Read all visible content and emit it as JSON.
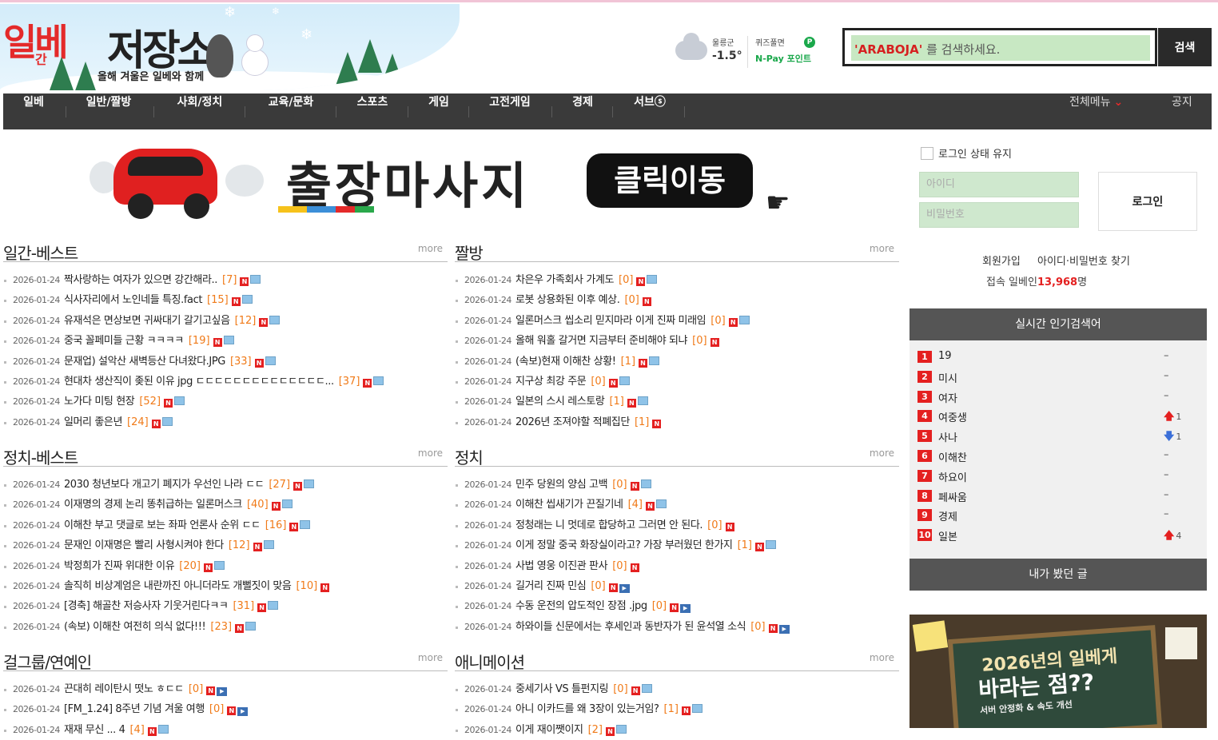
{
  "logo": {
    "t1": "일베",
    "t2": "간",
    "t3": "저장소",
    "subtitle": "올해 겨울은 일베와 함께"
  },
  "weather": {
    "location": "울릉군",
    "temp": "-1.5°"
  },
  "quiz": {
    "line1": "퀴즈풀면",
    "line2": "N-Pay 포인트",
    "badge": "P"
  },
  "search": {
    "placeholder_highlight": "'ARABOJA'",
    "placeholder_rest": " 를 검색하세요.",
    "button": "검색"
  },
  "nav": {
    "items": [
      "일베",
      "일반/짤방",
      "사회/정치",
      "교육/문화",
      "스포츠",
      "게임",
      "고전게임",
      "경제",
      "서브ⓢ"
    ],
    "all_menu": "전체메뉴",
    "notice": "공지"
  },
  "banner": {
    "text": "출장마사지",
    "button": "클릭이동"
  },
  "sections": [
    {
      "title": "일간-베스트",
      "more": "more",
      "rows": [
        {
          "date": "2026-01-24",
          "title": "짝사랑하는 여자가 있으면 강간해라..",
          "count": "[7]",
          "icons": [
            "n",
            "p"
          ]
        },
        {
          "date": "2026-01-24",
          "title": "식사자리에서 노인네들 특징.fact",
          "count": "[15]",
          "icons": [
            "n",
            "p"
          ]
        },
        {
          "date": "2026-01-24",
          "title": "유재석은 면상보면 귀싸대기 갈기고싶음",
          "count": "[12]",
          "icons": [
            "n",
            "p"
          ]
        },
        {
          "date": "2026-01-24",
          "title": "중국 꼴페미들 근황 ㅋㅋㅋㅋ",
          "count": "[19]",
          "icons": [
            "n",
            "p"
          ]
        },
        {
          "date": "2026-01-24",
          "title": "문재업) 설악산 새벽등산 다녀왔다.JPG",
          "count": "[33]",
          "icons": [
            "n",
            "p"
          ]
        },
        {
          "date": "2026-01-24",
          "title": "현대차 생산직이 좆된 이유 jpg ㄷㄷㄷㄷㄷㄷㄷㄷㄷㄷㄷㄷㄷㄷ...",
          "count": "[37]",
          "icons": [
            "n",
            "p"
          ]
        },
        {
          "date": "2026-01-24",
          "title": "노가다 미팅 현장",
          "count": "[52]",
          "icons": [
            "n",
            "p"
          ]
        },
        {
          "date": "2026-01-24",
          "title": "일머리 좋은년",
          "count": "[24]",
          "icons": [
            "n",
            "p"
          ]
        }
      ]
    },
    {
      "title": "짤방",
      "more": "more",
      "rows": [
        {
          "date": "2026-01-24",
          "title": "차은우 가족회사 가계도",
          "count": "[0]",
          "icons": [
            "n",
            "p"
          ]
        },
        {
          "date": "2026-01-24",
          "title": "로봇 상용화된 이후 예상.",
          "count": "[0]",
          "icons": [
            "n"
          ]
        },
        {
          "date": "2026-01-24",
          "title": "일론머스크 씹소리 믿지마라 이게 진짜 미래임",
          "count": "[0]",
          "icons": [
            "n",
            "p"
          ]
        },
        {
          "date": "2026-01-24",
          "title": "올해 워홀 갈거면 지금부터 준비해야 되냐",
          "count": "[0]",
          "icons": [
            "n"
          ]
        },
        {
          "date": "2026-01-24",
          "title": "(속보)현재 이해찬 상황!",
          "count": "[1]",
          "icons": [
            "n",
            "p"
          ]
        },
        {
          "date": "2026-01-24",
          "title": "지구상 최강 주문",
          "count": "[0]",
          "icons": [
            "n",
            "p"
          ]
        },
        {
          "date": "2026-01-24",
          "title": "일본의 스시 레스토랑",
          "count": "[1]",
          "icons": [
            "n",
            "p"
          ]
        },
        {
          "date": "2026-01-24",
          "title": "2026년 조져야할 적폐집단",
          "count": "[1]",
          "icons": [
            "n"
          ]
        }
      ]
    },
    {
      "title": "정치-베스트",
      "more": "more",
      "rows": [
        {
          "date": "2026-01-24",
          "title": "2030 청년보다 개고기 폐지가 우선인 나라 ㄷㄷ",
          "count": "[27]",
          "icons": [
            "n",
            "p"
          ]
        },
        {
          "date": "2026-01-24",
          "title": "이재명의 경제 논리 똥취급하는 일론머스크",
          "count": "[40]",
          "icons": [
            "n",
            "p"
          ]
        },
        {
          "date": "2026-01-24",
          "title": "이해찬 부고 댓글로 보는 좌파 언론사 순위 ㄷㄷ",
          "count": "[16]",
          "icons": [
            "n",
            "p"
          ]
        },
        {
          "date": "2026-01-24",
          "title": "문재인 이재명은 빨리 사형시켜야 한다",
          "count": "[12]",
          "icons": [
            "n",
            "p"
          ]
        },
        {
          "date": "2026-01-24",
          "title": "박정희가 진짜 위대한 이유",
          "count": "[20]",
          "icons": [
            "n",
            "p"
          ]
        },
        {
          "date": "2026-01-24",
          "title": "솔직히 비상계엄은 내란까진 아니더라도 개뻘짓이 맞음",
          "count": "[10]",
          "icons": [
            "n"
          ]
        },
        {
          "date": "2026-01-24",
          "title": "[경축] 해골찬 저승사자 기웃거린다ㅋㅋ",
          "count": "[31]",
          "icons": [
            "n",
            "p"
          ]
        },
        {
          "date": "2026-01-24",
          "title": "(속보) 이해찬 여전히 의식 없다!!!",
          "count": "[23]",
          "icons": [
            "n",
            "p"
          ]
        }
      ]
    },
    {
      "title": "정치",
      "more": "more",
      "rows": [
        {
          "date": "2026-01-24",
          "title": "민주 당원의 양심 고백",
          "count": "[0]",
          "icons": [
            "n",
            "p"
          ]
        },
        {
          "date": "2026-01-24",
          "title": "이해찬 씹새기가 끈질기네",
          "count": "[4]",
          "icons": [
            "n",
            "p"
          ]
        },
        {
          "date": "2026-01-24",
          "title": "정청래는 니 멋데로 합당하고 그러면 안 된다.",
          "count": "[0]",
          "icons": [
            "n"
          ]
        },
        {
          "date": "2026-01-24",
          "title": "이게 정말 중국 화장실이라고? 가장 부러웠던 한가지",
          "count": "[1]",
          "icons": [
            "n",
            "p"
          ]
        },
        {
          "date": "2026-01-24",
          "title": "사법 영웅 이진관 판사",
          "count": "[0]",
          "icons": [
            "n"
          ]
        },
        {
          "date": "2026-01-24",
          "title": "길거리 진짜 민심",
          "count": "[0]",
          "icons": [
            "n",
            "v"
          ]
        },
        {
          "date": "2026-01-24",
          "title": "수동 운전의 압도적인 장점 .jpg",
          "count": "[0]",
          "icons": [
            "n",
            "v"
          ]
        },
        {
          "date": "2026-01-24",
          "title": "하와이들 신문에서는 후세인과 동반자가 된 윤석열 소식",
          "count": "[0]",
          "icons": [
            "n",
            "v"
          ]
        }
      ]
    },
    {
      "title": "걸그룹/연예인",
      "more": "more",
      "rows": [
        {
          "date": "2026-01-24",
          "title": "끈대히 레이탄시 떳노 ㅎㄷㄷ",
          "count": "[0]",
          "icons": [
            "n",
            "v"
          ]
        },
        {
          "date": "2026-01-24",
          "title": "[FM_1.24] 8주년 기념 겨울 여행",
          "count": "[0]",
          "icons": [
            "n",
            "v"
          ]
        },
        {
          "date": "2026-01-24",
          "title": "재재 무신 ... 4",
          "count": "[4]",
          "icons": [
            "n",
            "p"
          ]
        }
      ]
    },
    {
      "title": "애니메이션",
      "more": "more",
      "rows": [
        {
          "date": "2026-01-24",
          "title": "중세기사 VS 틀펀지링",
          "count": "[0]",
          "icons": [
            "n",
            "p"
          ]
        },
        {
          "date": "2026-01-24",
          "title": "아니 이카드를 왜 3장이 있는거임?",
          "count": "[1]",
          "icons": [
            "n",
            "p"
          ]
        },
        {
          "date": "2026-01-24",
          "title": "이게 재이쨋이지",
          "count": "[2]",
          "icons": [
            "n",
            "p"
          ]
        }
      ]
    }
  ],
  "login": {
    "keep": "로그인 상태 유지",
    "id_placeholder": "아이디",
    "pw_placeholder": "비밀번호",
    "button": "로그인",
    "join": "회원가입",
    "find": "아이디·비밀번호 찾기",
    "users_label": "접속 일베인",
    "users_count": "13,968",
    "users_unit": "명"
  },
  "ranking": {
    "title": "실시간 인기검색어",
    "items": [
      {
        "num": "1",
        "keyword": "19",
        "change": "–",
        "dir": "none",
        "delta": ""
      },
      {
        "num": "2",
        "keyword": "미시",
        "change": "–",
        "dir": "none",
        "delta": ""
      },
      {
        "num": "3",
        "keyword": "여자",
        "change": "–",
        "dir": "none",
        "delta": ""
      },
      {
        "num": "4",
        "keyword": "여중생",
        "change": "🡅",
        "dir": "up",
        "delta": "1"
      },
      {
        "num": "5",
        "keyword": "사나",
        "change": "🡇",
        "dir": "down",
        "delta": "1"
      },
      {
        "num": "6",
        "keyword": "이해찬",
        "change": "–",
        "dir": "none",
        "delta": ""
      },
      {
        "num": "7",
        "keyword": "하요이",
        "change": "–",
        "dir": "none",
        "delta": ""
      },
      {
        "num": "8",
        "keyword": "페싸움",
        "change": "–",
        "dir": "none",
        "delta": ""
      },
      {
        "num": "9",
        "keyword": "경제",
        "change": "–",
        "dir": "none",
        "delta": ""
      },
      {
        "num": "10",
        "keyword": "일본",
        "change": "🡅",
        "dir": "up",
        "delta": "4"
      }
    ]
  },
  "viewed": {
    "title": "내가 봤던 글"
  },
  "ad": {
    "line1": "2026년의 일베게",
    "line2": "바라는 점??",
    "line3": "서버 안정화 & 속도 개선"
  }
}
